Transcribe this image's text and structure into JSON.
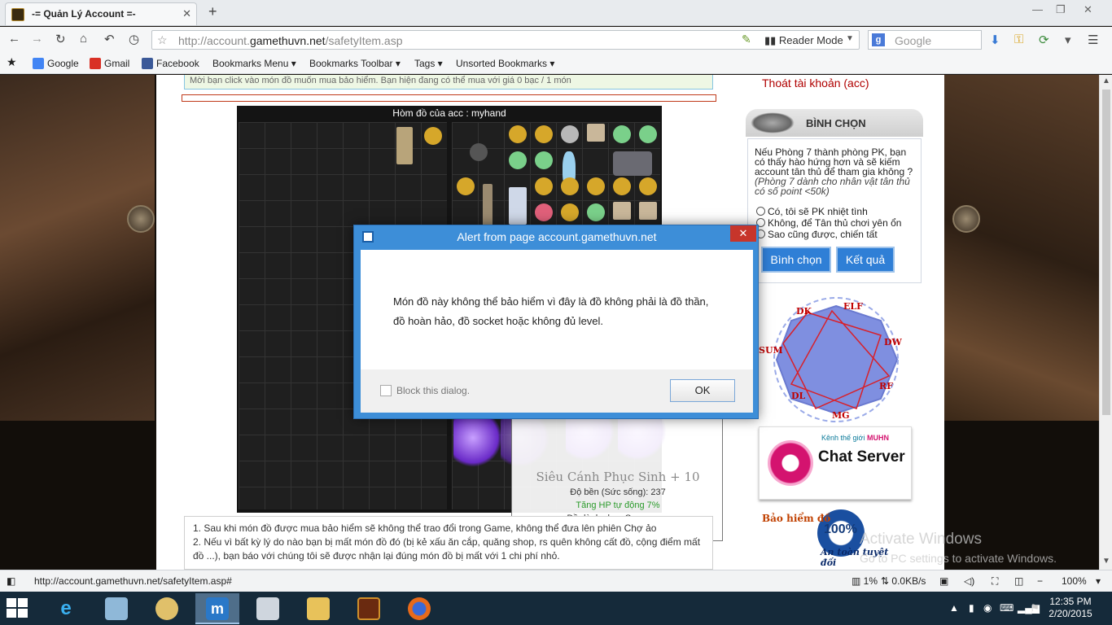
{
  "browser": {
    "tab_title": "-= Quản Lý Account =-",
    "tab_close": "✕",
    "new_tab": "+",
    "window_controls": [
      "—",
      "❐",
      "✕"
    ],
    "url_prefix": "http://account.",
    "url_domain": "gamethuvn.net",
    "url_path": "/safetyItem.asp",
    "reader_mode": "Reader Mode",
    "search_placeholder": "Google",
    "bookmarks": [
      {
        "label": "Google",
        "color": "#4285f4"
      },
      {
        "label": "Gmail",
        "color": "#d93025"
      },
      {
        "label": "Facebook",
        "color": "#3b5998"
      },
      {
        "label": "Bookmarks Menu ▾"
      },
      {
        "label": "Bookmarks Toolbar ▾"
      },
      {
        "label": "Tags ▾"
      },
      {
        "label": "Unsorted Bookmarks ▾"
      }
    ]
  },
  "page": {
    "notice": "Mời bạn click vào món đồ muốn mua bảo hiểm. Bạn hiện đang có thể mua với giá 0 bạc / 1 món",
    "inventory_title": "Hòm đồ của acc : myhand",
    "tooltip": {
      "name": "Siêu Cánh Phục Sinh + 10",
      "durability": "Độ bền (Sức sống): 237",
      "hp_bonus": "Tăng HP tự động 7%",
      "for_class": "Đồ dành cho : Summoner",
      "stars": "★★★★★★"
    },
    "notes": [
      "1. Sau khi món đồ được mua bảo hiểm sẽ không thể trao đổi trong Game, không thể đưa lên phiên Chợ ảo",
      "2. Nếu vì bất kỳ lý do nào bạn bị mất món đồ đó (bị kẻ xấu ăn cắp, quăng shop, rs quên không cất đồ, cộng điểm mất đồ ...), bạn báo với chúng tôi sẽ được nhận lại đúng món đồ bị mất với 1 chi phí nhỏ."
    ]
  },
  "sidebar": {
    "logout": "Thoát tài khoản (acc)",
    "vote_title": "BÌNH CHỌN",
    "vote_question": "Nếu Phòng 7 thành phòng PK, bạn có thấy hào hứng hơn và sẽ kiếm account tân thủ để tham gia không ?",
    "vote_note": "(Phòng 7 dành cho nhân vật tân thủ có số point <50k)",
    "vote_options": [
      "Có, tôi sẽ PK nhiệt tình",
      "Không, để Tân thủ chơi yên ổn",
      "Sao cũng được, chiến tất"
    ],
    "vote_button": "Bình chọn",
    "result_button": "Kết quả",
    "classes": [
      "DK",
      "ELF",
      "DW",
      "RF",
      "MG",
      "DL",
      "SUM"
    ],
    "chat_small_1": "Kênh thế giới",
    "chat_small_2": "MUHN",
    "chat_big": "Chat Server",
    "insurance_title": "Bảo hiểm đồ",
    "insurance_100": "100%",
    "insurance_sub": "An toàn tuyệt đối"
  },
  "dialog": {
    "title": "Alert from page account.gamethuvn.net",
    "close": "✕",
    "message": "Món đồ này không thể bảo hiểm vì đây là đồ không phải là đồ thần, đồ hoàn hảo, đồ socket hoặc không đủ level.",
    "block_label": "Block this dialog.",
    "ok": "OK"
  },
  "watermark": {
    "line1": "Activate Windows",
    "line2": "Go to PC settings to activate Windows."
  },
  "statusbar": {
    "url": "http://account.gamethuvn.net/safetyItem.asp#",
    "cpu": "1%",
    "net": "0.0KB/s",
    "zoom": "100%"
  },
  "taskbar": {
    "time": "12:35 PM",
    "date": "2/20/2015"
  }
}
